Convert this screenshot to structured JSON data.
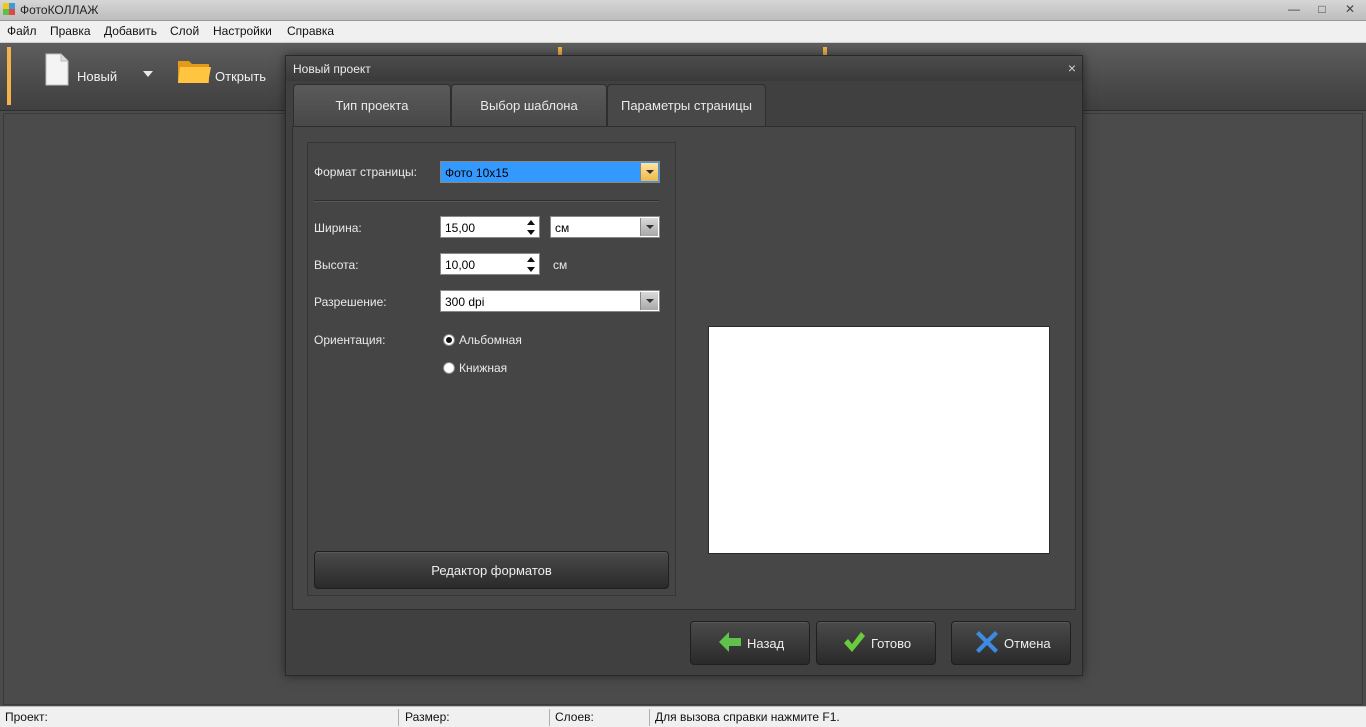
{
  "window": {
    "title": "ФотоКОЛЛАЖ",
    "controls": [
      "—",
      "□",
      "✕"
    ]
  },
  "menu": [
    "Файл",
    "Правка",
    "Добавить",
    "Слой",
    "Настройки",
    "Справка"
  ],
  "toolbar": {
    "new_label": "Новый",
    "open_label": "Открыть"
  },
  "dialog": {
    "title": "Новый проект",
    "close": "×",
    "tabs": [
      {
        "label": "Тип проекта",
        "active": false
      },
      {
        "label": "Выбор шаблона",
        "active": false
      },
      {
        "label": "Параметры страницы",
        "active": true
      }
    ],
    "form": {
      "format_label": "Формат страницы:",
      "format_value": "Фото 10x15",
      "width_label": "Ширина:",
      "width_value": "15,00",
      "unit_value": "см",
      "height_label": "Высота:",
      "height_value": "10,00",
      "height_unit": "см",
      "resolution_label": "Разрешение:",
      "resolution_value": "300 dpi",
      "orientation_label": "Ориентация:",
      "orientation_options": [
        {
          "label": "Альбомная",
          "checked": true
        },
        {
          "label": "Книжная",
          "checked": false
        }
      ],
      "format_editor_label": "Редактор форматов"
    },
    "buttons": {
      "back": "Назад",
      "done": "Готово",
      "cancel": "Отмена"
    }
  },
  "statusbar": {
    "project": "Проект:",
    "size": "Размер:",
    "layers": "Слоев:",
    "hint": "Для вызова справки нажмите F1."
  },
  "colors": {
    "accent": "#f3b34a",
    "selection": "#3399ff",
    "back_arrow": "#5fc24a",
    "done_check": "#6acb3c",
    "cancel_x": "#3d8be0"
  }
}
